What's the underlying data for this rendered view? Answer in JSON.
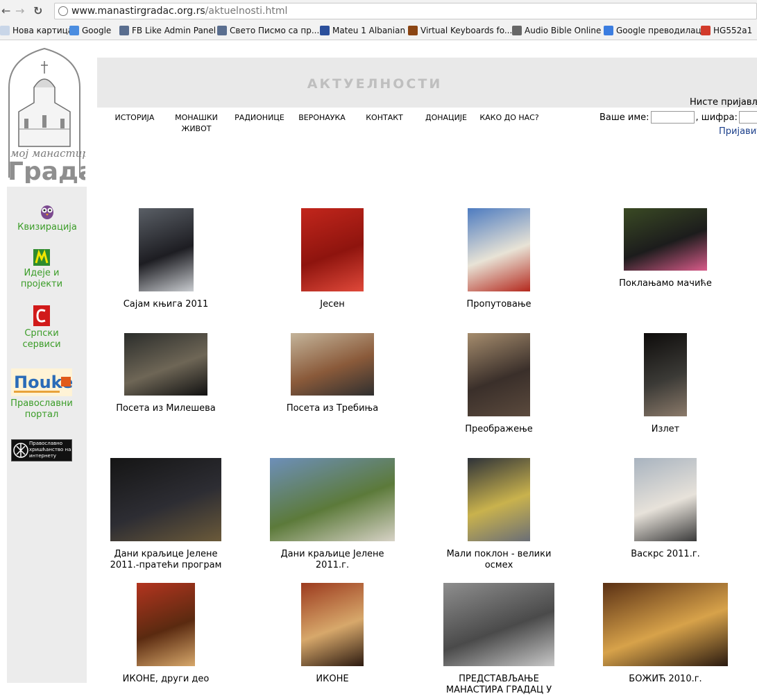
{
  "browser": {
    "url_host": "www.manastirgradac.org.rs",
    "url_path": "/aktuelnosti.html",
    "bookmarks": [
      {
        "label": "Нова картица",
        "icon": "page-icon",
        "color": "#c9d6e8"
      },
      {
        "label": "Google",
        "icon": "google-icon",
        "color": "#4b8de0"
      },
      {
        "label": "FB Like Admin Panel",
        "icon": "bookmark-icon",
        "color": "#5a6e8f"
      },
      {
        "label": "Свето Писмо са пр...",
        "icon": "bookmark-icon",
        "color": "#5a6e8f"
      },
      {
        "label": "Mateu 1 Albanian",
        "icon": "bible-icon",
        "color": "#2b4f9b"
      },
      {
        "label": "Virtual Keyboards fo...",
        "icon": "keyboard-icon",
        "color": "#8b4513"
      },
      {
        "label": "Audio Bible Online",
        "icon": "audio-icon",
        "color": "#666666"
      },
      {
        "label": "Google преводилац",
        "icon": "translate-icon",
        "color": "#3b7de0"
      },
      {
        "label": "HG552a1",
        "icon": "router-icon",
        "color": "#d23b2b"
      }
    ]
  },
  "header": {
    "title": "АКТУЕЛНОСТИ",
    "login_status": "Нисте пријављ",
    "username_label": "Ваше име:",
    "password_label": ", шифра:",
    "login_link": "Пријавит"
  },
  "menu": [
    "ИСТОРИЈА",
    "МОНАШКИ ЖИВОТ",
    "РАДИОНИЦЕ",
    "ВЕРОНАУКА",
    "КОНТАКТ",
    "ДОНАЦИЈЕ",
    "КАКО ДО НАС?"
  ],
  "sidebar": [
    {
      "label": "Квизирација",
      "icon": "owl-icon"
    },
    {
      "label": "Идеје и пројекти",
      "icon": "ideas-icon"
    },
    {
      "label": "Српски сервиси",
      "icon": "serbian-services-icon"
    },
    {
      "label": "Православни портал",
      "icon": "pouke-logo-icon"
    },
    {
      "label": "Православно хришћанство на интернету",
      "icon": "orthodox-internet-banner"
    }
  ],
  "gallery": [
    {
      "caption": "Сајам књига 2011",
      "colors": [
        "#5a5f66",
        "#1d1d22",
        "#c9ccd0"
      ]
    },
    {
      "caption": "Јесен",
      "colors": [
        "#c2261c",
        "#8e140e",
        "#e0493a"
      ]
    },
    {
      "caption": "Пропутовање",
      "colors": [
        "#4d7bc0",
        "#e8e3d6",
        "#b4281d"
      ]
    },
    {
      "caption": "Поклањамо мачиће",
      "colors": [
        "#3a4a24",
        "#1c1c1c",
        "#d95b8a"
      ]
    },
    {
      "caption": "Посета из Милешева",
      "colors": [
        "#2b2d2b",
        "#6e6656",
        "#111111"
      ]
    },
    {
      "caption": "Посета из Требиња",
      "colors": [
        "#c4b49a",
        "#8a5a3a",
        "#2f2f2f"
      ]
    },
    {
      "caption": "Преображење",
      "colors": [
        "#a58c6d",
        "#3a2f2a",
        "#5b4a3d"
      ]
    },
    {
      "caption": "Излет",
      "colors": [
        "#0e0c0b",
        "#3b3a36",
        "#8b7a6a"
      ]
    },
    {
      "caption": "Дани краљице Јелене 2011.-пратећи програм",
      "colors": [
        "#151515",
        "#2d2d33",
        "#6b5a3a"
      ]
    },
    {
      "caption": "Дани краљице Јелене 2011.г.",
      "colors": [
        "#6d8fb9",
        "#5c7a3a",
        "#d7d2c6"
      ]
    },
    {
      "caption": "Мали поклон - велики осмех",
      "colors": [
        "#2e3238",
        "#c9b24d",
        "#6a6e76"
      ]
    },
    {
      "caption": "Васкрс 2011.г.",
      "colors": [
        "#a8b3bf",
        "#e7e2da",
        "#3a3a3a"
      ]
    },
    {
      "caption": "ИКОНЕ, други део",
      "colors": [
        "#b3341f",
        "#5a2a10",
        "#d7a86b"
      ]
    },
    {
      "caption": "ИКОНЕ",
      "colors": [
        "#9c3a1e",
        "#d7a86b",
        "#2c1a10"
      ]
    },
    {
      "caption": "ПРЕДСТАВЉАЊЕ МАНАСТИРА ГРАДАЦ У",
      "colors": [
        "#8e8e8e",
        "#4a4a4a",
        "#c8c8c8"
      ]
    },
    {
      "caption": "БОЖИЋ 2010.г.",
      "colors": [
        "#5a3014",
        "#d7a24a",
        "#2a1a10"
      ]
    }
  ]
}
